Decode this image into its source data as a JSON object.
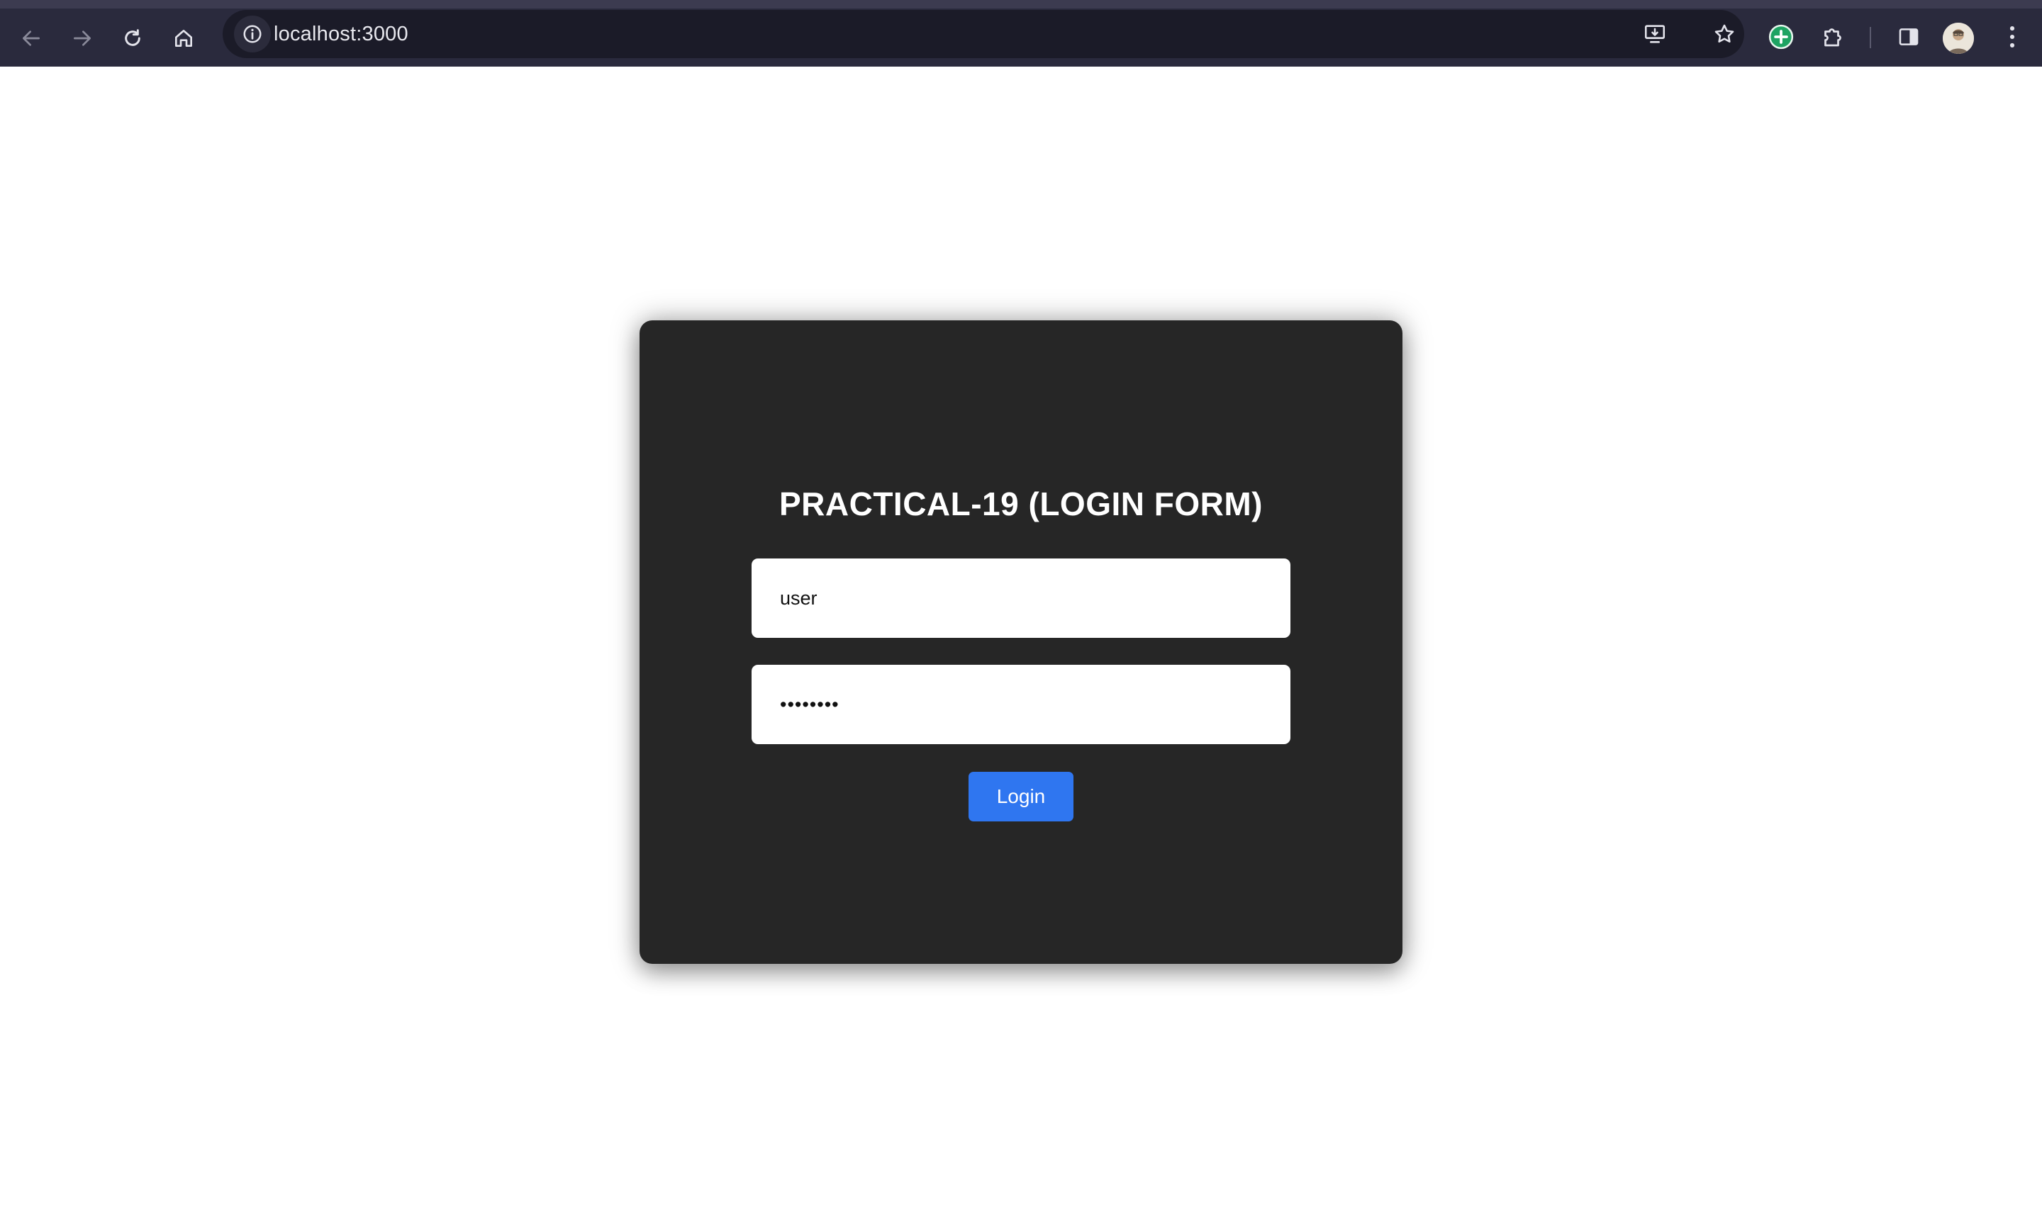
{
  "browser": {
    "url": "localhost:3000",
    "icons": {
      "back": "arrow-left-icon",
      "forward": "arrow-right-icon",
      "reload": "reload-icon",
      "home": "home-icon",
      "site_info": "info-circle-icon",
      "install": "install-app-icon",
      "bookmark": "star-icon",
      "extension_green": "plus-circle-icon",
      "extensions": "puzzle-icon",
      "side_panel": "side-panel-icon",
      "profile": "avatar-icon",
      "menu": "kebab-menu-icon"
    },
    "colors": {
      "toolbar_bg": "#2a2a3d",
      "omnibox_bg": "#1b1b28",
      "extension_accent": "#1ea362"
    }
  },
  "page": {
    "title": "PRACTICAL-19 (LOGIN FORM)",
    "username_value": "user",
    "password_value": "password",
    "login_label": "Login",
    "colors": {
      "card_bg": "#262626",
      "button_bg": "#2f76f0",
      "page_bg": "#ffffff"
    }
  }
}
